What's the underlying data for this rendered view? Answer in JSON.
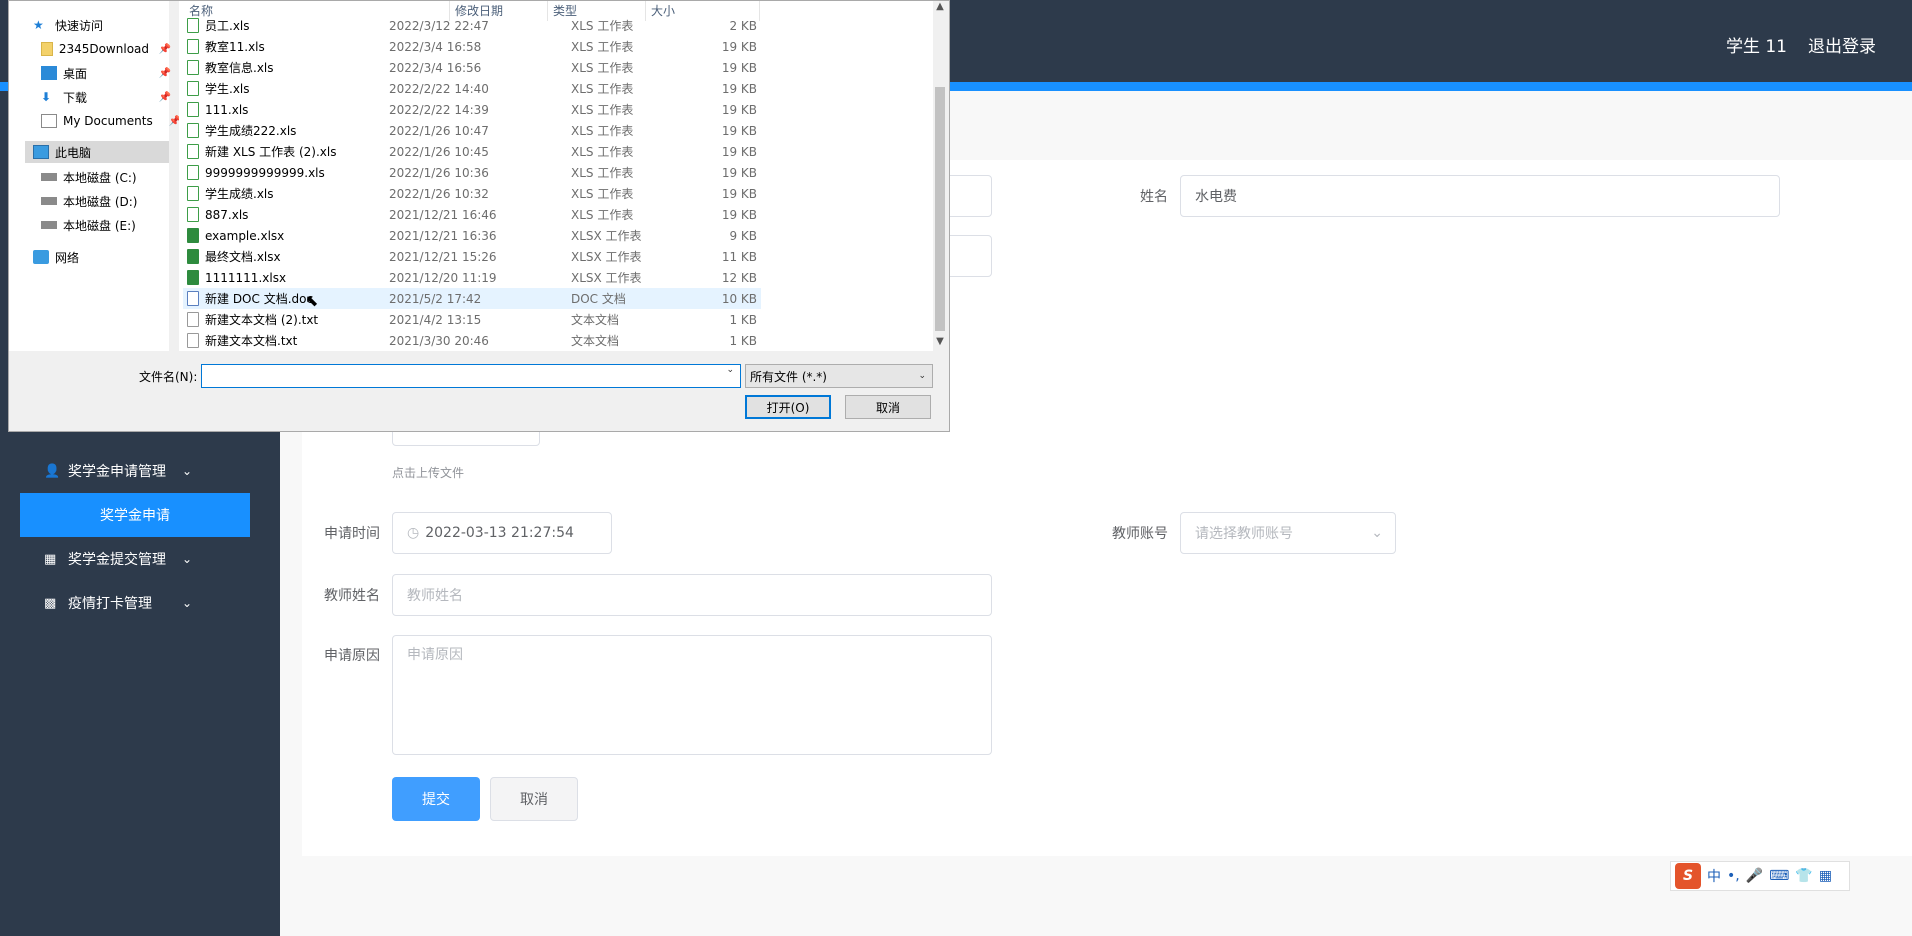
{
  "header": {
    "user": "学生 11",
    "logout": "退出登录"
  },
  "sidebar": {
    "items": [
      {
        "label": "奖学金申请管理",
        "icon": "user-icon"
      },
      {
        "label": "奖学金申请",
        "active": true
      },
      {
        "label": "奖学金提交管理",
        "icon": "grid-icon"
      },
      {
        "label": "疫情打卡管理",
        "icon": "ticket-icon"
      }
    ]
  },
  "form": {
    "name_label": "姓名",
    "name_value": "水电费",
    "upload_hint": "点击上传文件",
    "time_label": "申请时间",
    "time_value": "2022-03-13 21:27:54",
    "teacher_account_label": "教师账号",
    "teacher_account_placeholder": "请选择教师账号",
    "teacher_name_label": "教师姓名",
    "teacher_name_placeholder": "教师姓名",
    "reason_label": "申请原因",
    "reason_placeholder": "申请原因",
    "submit": "提交",
    "cancel": "取消"
  },
  "ime": {
    "logo": "S",
    "mode": "中",
    "punct": "•,"
  },
  "dialog": {
    "nav": [
      {
        "label": "快速访问",
        "icon": "star-icon"
      },
      {
        "label": "2345Download",
        "icon": "folder-icon"
      },
      {
        "label": "桌面",
        "icon": "desktop-icon"
      },
      {
        "label": "下载",
        "icon": "download-icon"
      },
      {
        "label": "My Documents",
        "icon": "document-icon"
      },
      {
        "label": "此电脑",
        "icon": "computer-icon"
      },
      {
        "label": "本地磁盘 (C:)",
        "icon": "drive-icon"
      },
      {
        "label": "本地磁盘 (D:)",
        "icon": "drive-icon"
      },
      {
        "label": "本地磁盘 (E:)",
        "icon": "drive-icon"
      },
      {
        "label": "网络",
        "icon": "network-icon"
      }
    ],
    "columns": [
      "名称",
      "修改日期",
      "类型",
      "大小"
    ],
    "files": [
      {
        "name": "员工.xls",
        "date": "2022/3/12 22:47",
        "type": "XLS 工作表",
        "size": "2 KB",
        "kind": "xls"
      },
      {
        "name": "教室11.xls",
        "date": "2022/3/4 16:58",
        "type": "XLS 工作表",
        "size": "19 KB",
        "kind": "xls"
      },
      {
        "name": "教室信息.xls",
        "date": "2022/3/4 16:56",
        "type": "XLS 工作表",
        "size": "19 KB",
        "kind": "xls"
      },
      {
        "name": "学生.xls",
        "date": "2022/2/22 14:40",
        "type": "XLS 工作表",
        "size": "19 KB",
        "kind": "xls"
      },
      {
        "name": "111.xls",
        "date": "2022/2/22 14:39",
        "type": "XLS 工作表",
        "size": "19 KB",
        "kind": "xls"
      },
      {
        "name": "学生成绩222.xls",
        "date": "2022/1/26 10:47",
        "type": "XLS 工作表",
        "size": "19 KB",
        "kind": "xls"
      },
      {
        "name": "新建 XLS 工作表 (2).xls",
        "date": "2022/1/26 10:45",
        "type": "XLS 工作表",
        "size": "19 KB",
        "kind": "xls"
      },
      {
        "name": "9999999999999.xls",
        "date": "2022/1/26 10:36",
        "type": "XLS 工作表",
        "size": "19 KB",
        "kind": "xls"
      },
      {
        "name": "学生成绩.xls",
        "date": "2022/1/26 10:32",
        "type": "XLS 工作表",
        "size": "19 KB",
        "kind": "xls"
      },
      {
        "name": "887.xls",
        "date": "2021/12/21 16:46",
        "type": "XLS 工作表",
        "size": "19 KB",
        "kind": "xls"
      },
      {
        "name": "example.xlsx",
        "date": "2021/12/21 16:36",
        "type": "XLSX 工作表",
        "size": "9 KB",
        "kind": "xlsx"
      },
      {
        "name": "最终文档.xlsx",
        "date": "2021/12/21 15:26",
        "type": "XLSX 工作表",
        "size": "11 KB",
        "kind": "xlsx"
      },
      {
        "name": "1111111.xlsx",
        "date": "2021/12/20 11:19",
        "type": "XLSX 工作表",
        "size": "12 KB",
        "kind": "xlsx"
      },
      {
        "name": "新建 DOC 文档.doc",
        "date": "2021/5/2 17:42",
        "type": "DOC 文档",
        "size": "10 KB",
        "kind": "doc",
        "hover": true
      },
      {
        "name": "新建文本文档 (2).txt",
        "date": "2021/4/2 13:15",
        "type": "文本文档",
        "size": "1 KB",
        "kind": "txt"
      },
      {
        "name": "新建文本文档.txt",
        "date": "2021/3/30 20:46",
        "type": "文本文档",
        "size": "1 KB",
        "kind": "txt"
      }
    ],
    "filename_label": "文件名(N):",
    "filename_value": "",
    "filter": "所有文件 (*.*)",
    "open": "打开(O)",
    "cancel": "取消"
  }
}
